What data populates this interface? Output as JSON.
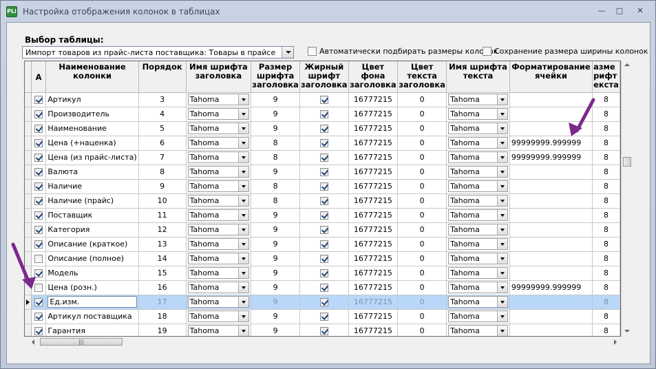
{
  "window": {
    "title": "Настройка отображения колонок в таблицах",
    "app_icon_text": "PLi",
    "minimize": "—",
    "maximize": "□",
    "close": "✕"
  },
  "table_select": {
    "label": "Выбор таблицы:",
    "value": "Импорт товаров из прайс-листа поставщика: Товары в прайсе"
  },
  "options": {
    "auto_fit_label": "Автоматически подбирать размеры колонок",
    "auto_fit_checked": false,
    "save_width_label": "Сохранение размера ширины колонок",
    "save_width_checked": false
  },
  "grid": {
    "headers": {
      "active": "А",
      "name": "Наименование колонки",
      "order": "Порядок",
      "header_font": "Имя шрифта заголовка",
      "header_size": "Размер шрифта заголовка",
      "bold_font": "Жирный шрифт заголовка",
      "bg_color": "Цвет фона заголовка",
      "text_color": "Цвет текста заголовка",
      "text_font": "Имя шрифта текста",
      "format": "Форматирование ячейки",
      "partial": "азме рифт екста"
    },
    "rows": [
      {
        "active": true,
        "name": "Артикул",
        "order": "3",
        "hfont": "Tahoma",
        "hsize": "9",
        "bold": true,
        "bg": "16777215",
        "fg": "0",
        "tfont": "Tahoma",
        "format": "",
        "tsize": "8"
      },
      {
        "active": true,
        "name": "Производитель",
        "order": "4",
        "hfont": "Tahoma",
        "hsize": "9",
        "bold": true,
        "bg": "16777215",
        "fg": "0",
        "tfont": "Tahoma",
        "format": "",
        "tsize": "8"
      },
      {
        "active": true,
        "name": "Наименование",
        "order": "5",
        "hfont": "Tahoma",
        "hsize": "9",
        "bold": true,
        "bg": "16777215",
        "fg": "0",
        "tfont": "Tahoma",
        "format": "",
        "tsize": "8"
      },
      {
        "active": true,
        "name": "Цена (+наценка)",
        "order": "6",
        "hfont": "Tahoma",
        "hsize": "8",
        "bold": true,
        "bg": "16777215",
        "fg": "0",
        "tfont": "Tahoma",
        "format": "99999999.999999",
        "tsize": "8"
      },
      {
        "active": true,
        "name": "Цена (из прайс-листа)",
        "order": "7",
        "hfont": "Tahoma",
        "hsize": "8",
        "bold": true,
        "bg": "16777215",
        "fg": "0",
        "tfont": "Tahoma",
        "format": "99999999.999999",
        "tsize": "8"
      },
      {
        "active": true,
        "name": "Валюта",
        "order": "8",
        "hfont": "Tahoma",
        "hsize": "9",
        "bold": true,
        "bg": "16777215",
        "fg": "0",
        "tfont": "Tahoma",
        "format": "",
        "tsize": "8"
      },
      {
        "active": true,
        "name": "Наличие",
        "order": "9",
        "hfont": "Tahoma",
        "hsize": "8",
        "bold": true,
        "bg": "16777215",
        "fg": "0",
        "tfont": "Tahoma",
        "format": "",
        "tsize": "8"
      },
      {
        "active": true,
        "name": "Наличие (прайс)",
        "order": "10",
        "hfont": "Tahoma",
        "hsize": "8",
        "bold": true,
        "bg": "16777215",
        "fg": "0",
        "tfont": "Tahoma",
        "format": "",
        "tsize": "8"
      },
      {
        "active": true,
        "name": "Поставщик",
        "order": "11",
        "hfont": "Tahoma",
        "hsize": "9",
        "bold": true,
        "bg": "16777215",
        "fg": "0",
        "tfont": "Tahoma",
        "format": "",
        "tsize": "8"
      },
      {
        "active": true,
        "name": "Категория",
        "order": "12",
        "hfont": "Tahoma",
        "hsize": "9",
        "bold": true,
        "bg": "16777215",
        "fg": "0",
        "tfont": "Tahoma",
        "format": "",
        "tsize": "8"
      },
      {
        "active": true,
        "name": "Описание (краткое)",
        "order": "13",
        "hfont": "Tahoma",
        "hsize": "9",
        "bold": true,
        "bg": "16777215",
        "fg": "0",
        "tfont": "Tahoma",
        "format": "",
        "tsize": "8"
      },
      {
        "active": false,
        "name": "Описание (полное)",
        "order": "14",
        "hfont": "Tahoma",
        "hsize": "9",
        "bold": true,
        "bg": "16777215",
        "fg": "0",
        "tfont": "Tahoma",
        "format": "",
        "tsize": "8"
      },
      {
        "active": true,
        "name": "Модель",
        "order": "15",
        "hfont": "Tahoma",
        "hsize": "9",
        "bold": true,
        "bg": "16777215",
        "fg": "0",
        "tfont": "Tahoma",
        "format": "",
        "tsize": "8"
      },
      {
        "active": false,
        "name": "Цена (розн.)",
        "order": "16",
        "hfont": "Tahoma",
        "hsize": "9",
        "bold": true,
        "bg": "16777215",
        "fg": "0",
        "tfont": "Tahoma",
        "format": "99999999.999999",
        "tsize": "8"
      },
      {
        "active": true,
        "name": "Ед.изм.",
        "order": "17",
        "hfont": "Tahoma",
        "hsize": "9",
        "bold": true,
        "bg": "16777215",
        "fg": "0",
        "tfont": "Tahoma",
        "format": "",
        "tsize": "8",
        "selected": true
      },
      {
        "active": true,
        "name": "Артикул поставщика",
        "order": "18",
        "hfont": "Tahoma",
        "hsize": "9",
        "bold": true,
        "bg": "16777215",
        "fg": "0",
        "tfont": "Tahoma",
        "format": "",
        "tsize": "8"
      },
      {
        "active": true,
        "name": "Гарантия",
        "order": "19",
        "hfont": "Tahoma",
        "hsize": "9",
        "bold": true,
        "bg": "16777215",
        "fg": "0",
        "tfont": "Tahoma",
        "format": "",
        "tsize": "8"
      }
    ]
  },
  "colors": {
    "selection": "#b9d7f8",
    "annotation_arrow": "#7b2a8c"
  },
  "icons": {
    "dropdown": "chevron-down-icon",
    "checkbox": "checkbox-icon"
  },
  "hscroll_thumb_glyph": "|||"
}
